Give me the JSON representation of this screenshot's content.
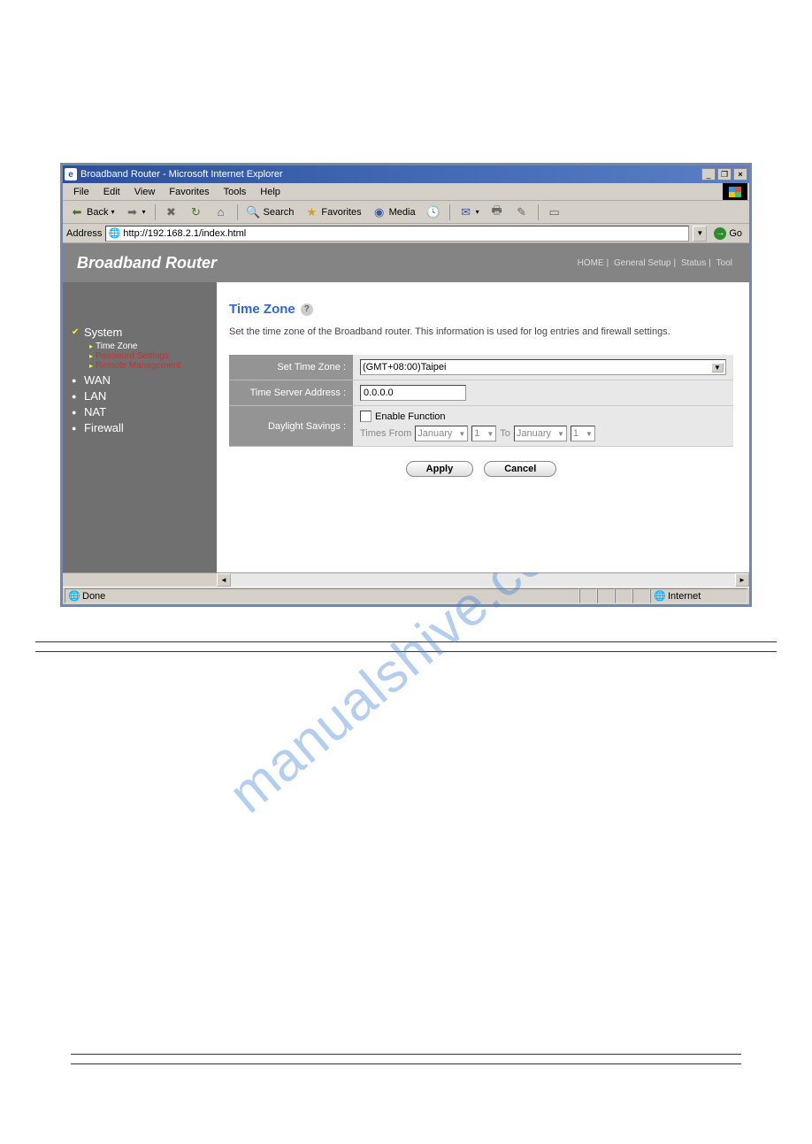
{
  "window": {
    "title": "Broadband Router - Microsoft Internet Explorer",
    "menu": {
      "file": "File",
      "edit": "Edit",
      "view": "View",
      "favorites": "Favorites",
      "tools": "Tools",
      "help": "Help"
    },
    "toolbar": {
      "back": "Back",
      "search": "Search",
      "favorites": "Favorites",
      "media": "Media"
    },
    "address_label": "Address",
    "address_value": "http://192.168.2.1/index.html",
    "go": "Go",
    "status_left": "Done",
    "status_zone": "Internet"
  },
  "router": {
    "brand": "Broadband Router",
    "nav": {
      "home": "HOME",
      "general": "General Setup",
      "status": "Status",
      "tool": "Tool"
    }
  },
  "sidebar": {
    "system": "System",
    "subs": {
      "timezone": "Time Zone",
      "password": "Password Settings",
      "remote": "Remote Management"
    },
    "wan": "WAN",
    "lan": "LAN",
    "nat": "NAT",
    "firewall": "Firewall"
  },
  "page": {
    "title": "Time Zone",
    "desc": "Set the time zone of the Broadband router. This information is used for log entries and firewall settings.",
    "labels": {
      "tz": "Set Time Zone :",
      "server": "Time Server Address :",
      "dst": "Daylight Savings :"
    },
    "tz_value": "(GMT+08:00)Taipei",
    "server_value": "0.0.0.0",
    "dst": {
      "enable": "Enable Function",
      "times_from": "Times From",
      "to": "To",
      "month1": "January",
      "day1": "1",
      "month2": "January",
      "day2": "1"
    },
    "buttons": {
      "apply": "Apply",
      "cancel": "Cancel"
    }
  },
  "watermark": "manualshive.com"
}
